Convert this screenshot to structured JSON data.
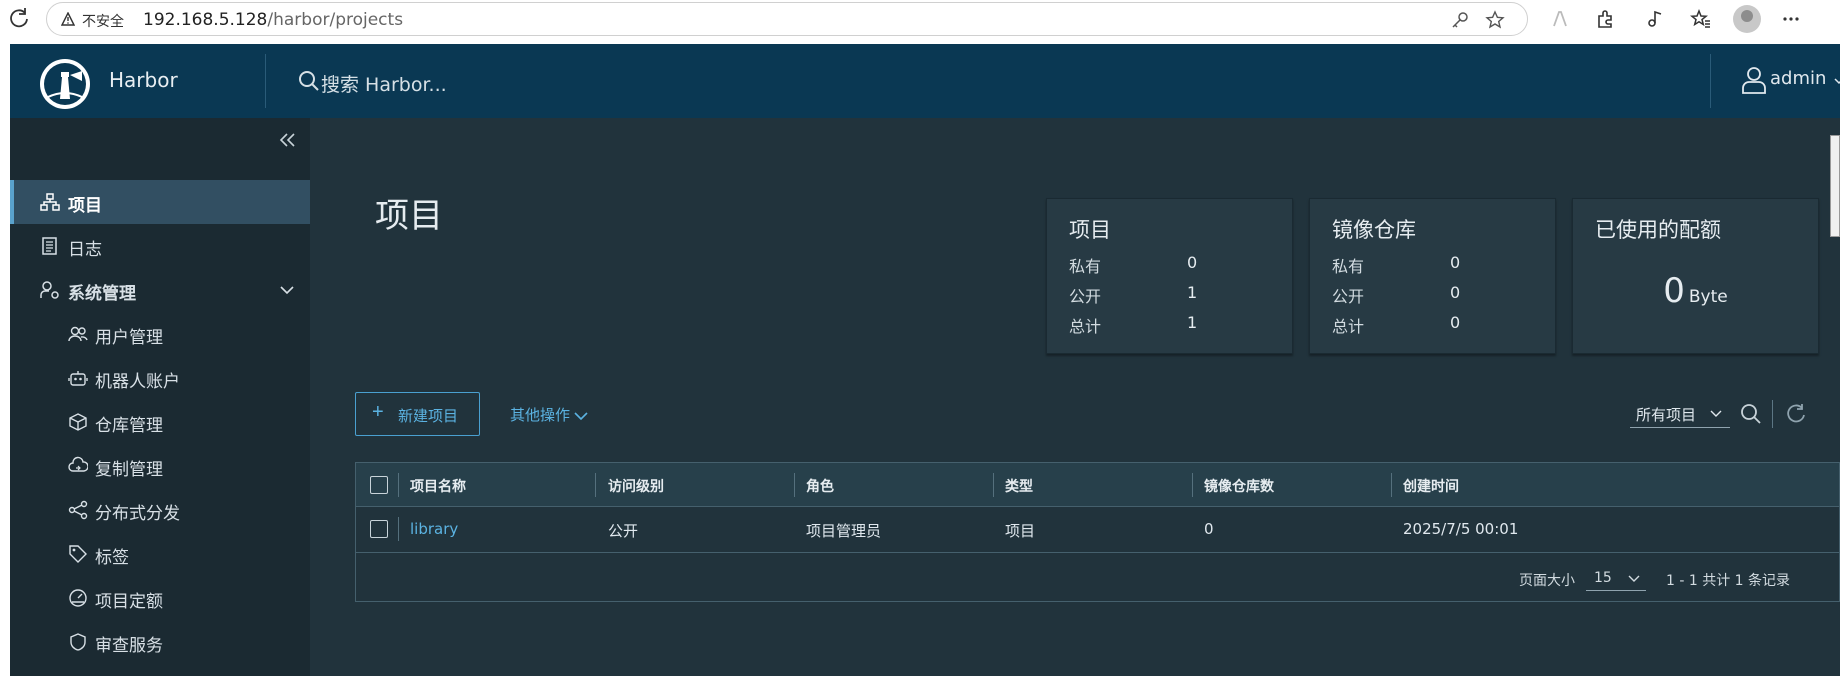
{
  "browser": {
    "security_label": "不安全",
    "url_host": "192.168.5.128",
    "url_path": "/harbor/projects"
  },
  "header": {
    "app_name": "Harbor",
    "search_placeholder": "搜索 Harbor...",
    "user": "admin"
  },
  "sidebar": {
    "items": [
      {
        "label": "项目",
        "icon": "projects-icon",
        "active": true
      },
      {
        "label": "日志",
        "icon": "logs-icon"
      },
      {
        "label": "系统管理",
        "icon": "admin-icon"
      },
      {
        "label": "用户管理",
        "icon": "users-icon"
      },
      {
        "label": "机器人账户",
        "icon": "robot-icon"
      },
      {
        "label": "仓库管理",
        "icon": "registry-icon"
      },
      {
        "label": "复制管理",
        "icon": "replication-icon"
      },
      {
        "label": "分布式分发",
        "icon": "distribution-icon"
      },
      {
        "label": "标签",
        "icon": "tag-icon"
      },
      {
        "label": "项目定额",
        "icon": "quota-icon"
      },
      {
        "label": "审查服务",
        "icon": "shield-icon"
      }
    ]
  },
  "main": {
    "title": "项目",
    "cards": {
      "projects": {
        "title": "项目",
        "rows": [
          {
            "label": "私有",
            "value": "0"
          },
          {
            "label": "公开",
            "value": "1"
          },
          {
            "label": "总计",
            "value": "1"
          }
        ]
      },
      "repos": {
        "title": "镜像仓库",
        "rows": [
          {
            "label": "私有",
            "value": "0"
          },
          {
            "label": "公开",
            "value": "0"
          },
          {
            "label": "总计",
            "value": "0"
          }
        ]
      },
      "quota": {
        "title": "已使用的配额",
        "value": "0",
        "unit": "Byte"
      }
    },
    "actions": {
      "new_project": "新建项目",
      "more_actions": "其他操作"
    },
    "filter": {
      "selected": "所有项目"
    },
    "table": {
      "columns": [
        "项目名称",
        "访问级别",
        "角色",
        "类型",
        "镜像仓库数",
        "创建时间"
      ],
      "rows": [
        {
          "name": "library",
          "access": "公开",
          "role": "项目管理员",
          "type": "项目",
          "repo_count": "0",
          "created": "2025/7/5 00:01"
        }
      ],
      "footer": {
        "page_size_label": "页面大小",
        "page_size": "15",
        "summary": "1 - 1 共计 1 条记录"
      }
    }
  }
}
